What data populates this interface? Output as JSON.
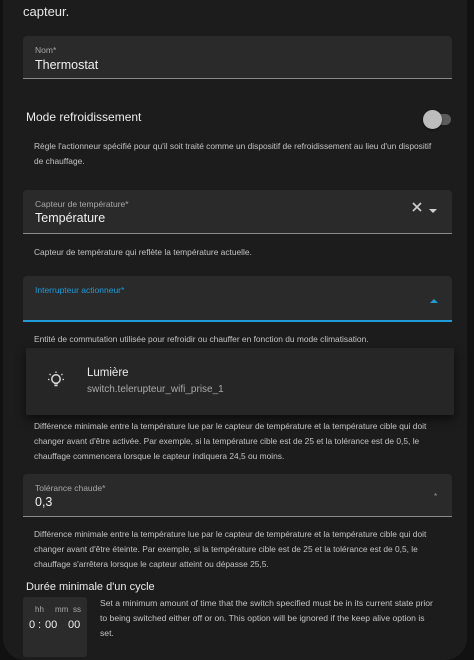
{
  "intro_text": "capteur.",
  "name_field": {
    "label": "Nom*",
    "value": "Thermostat"
  },
  "cooling": {
    "label": "Mode refroidissement",
    "enabled": false,
    "help": "Règle l'actionneur spécifié pour qu'il soit traité comme un dispositif de refroidissement au lieu d'un dispositif de chauffage."
  },
  "temp_sensor": {
    "label": "Capteur de température*",
    "value": "Température",
    "help": "Capteur de température qui reflète la température actuelle."
  },
  "actuator": {
    "label": "Interrupteur actionneur*",
    "value": "",
    "help": "Entité de commutation utilisée pour refroidir ou chauffer en fonction du mode climatisation.",
    "options": [
      {
        "name": "Lumière",
        "entity_id": "switch.telerupteur_wifi_prise_1",
        "icon": "lightbulb-icon"
      }
    ]
  },
  "cold_tolerance_help": "Différence minimale entre la température lue par le capteur de température et la température cible qui doit changer avant d'être activée. Par exemple, si la température cible est de 25 et la tolérance est de 0,5, le chauffage commencera lorsque le capteur indiquera 24,5 ou moins.",
  "hot_tolerance": {
    "label": "Tolérance chaude*",
    "value": "0,3",
    "help": "Différence minimale entre la température lue par le capteur de température et la température cible qui doit changer avant d'être éteinte. Par exemple, si la température cible est de 25 et la tolérance est de 0,5, le chauffage s'arrêtera lorsque le capteur atteint ou dépasse 25,5."
  },
  "min_cycle": {
    "title": "Durée minimale d'un cycle",
    "units": {
      "h": "hh",
      "m": "mm",
      "s": "ss"
    },
    "values": {
      "h": "0",
      "m": "00",
      "s": "00"
    },
    "help": "Set a minimum amount of time that the switch specified must be in its current state prior to being switched either off or on. This option will be ignored if the keep alive option is set."
  },
  "colors": {
    "accent": "#1f9bd8",
    "surface": "#1c1c1c",
    "field": "#2a2a2a"
  }
}
